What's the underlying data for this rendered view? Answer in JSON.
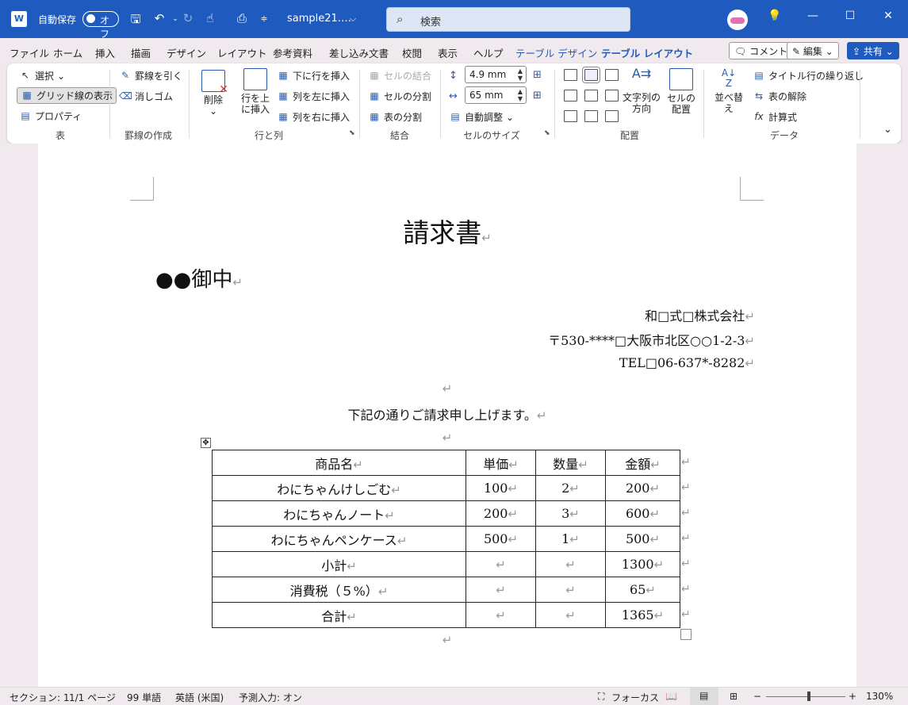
{
  "titlebar": {
    "app_icon": "W",
    "autosave_label": "自動保存",
    "autosave_state": "オフ",
    "file_name": "sample21.…",
    "search_placeholder": "検索",
    "icons": [
      "save-icon",
      "undo-icon",
      "redo-icon",
      "touch-mode-icon",
      "quick-access-icon",
      "customize-icon"
    ]
  },
  "menu": {
    "tabs": [
      "ファイル",
      "ホーム",
      "挿入",
      "描画",
      "デザイン",
      "レイアウト",
      "参考資料",
      "差し込み文書",
      "校閲",
      "表示",
      "ヘルプ",
      "テーブル デザイン",
      "テーブル レイアウト"
    ],
    "comment_label": "コメント",
    "edit_label": "編集",
    "share_label": "共有"
  },
  "ribbon": {
    "table": {
      "select": "選択",
      "gridlines": "グリッド線の表示",
      "properties": "プロパティ",
      "group": "表"
    },
    "draw": {
      "draw_border": "罫線を引く",
      "eraser": "消しゴム",
      "group": "罫線の作成"
    },
    "rows_cols": {
      "delete": "削除",
      "insert_above": "行を上\nに挿入",
      "insert_below": "下に行を挿入",
      "insert_left": "列を左に挿入",
      "insert_right": "列を右に挿入",
      "group": "行と列"
    },
    "merge": {
      "merge_cells": "セルの結合",
      "split_cells": "セルの分割",
      "split_table": "表の分割",
      "group": "結合"
    },
    "cell_size": {
      "height": "4.9 mm",
      "width": "65 mm",
      "autofit": "自動調整",
      "group": "セルのサイズ"
    },
    "alignment": {
      "text_direction": "文字列の\n方向",
      "cell_margins": "セルの\n配置",
      "group": "配置"
    },
    "data": {
      "sort": "並べ替え",
      "repeat_header": "タイトル行の繰り返し",
      "convert": "表の解除",
      "formula": "計算式",
      "group": "データ"
    }
  },
  "document": {
    "title": "請求書",
    "recipient": "●●御中",
    "company": "和□式□株式会社",
    "address": "〒530-****□大阪市北区○○1-2-3",
    "tel": "TEL□06-637*-8282",
    "intro": "下記の通りご請求申し上げます。",
    "para_mark": "↵",
    "table": {
      "headers": [
        "商品名",
        "単価",
        "数量",
        "金額"
      ],
      "rows": [
        [
          "わにちゃんけしごむ",
          "100",
          "2",
          "200"
        ],
        [
          "わにちゃんノート",
          "200",
          "3",
          "600"
        ],
        [
          "わにちゃんペンケース",
          "500",
          "1",
          "500"
        ],
        [
          "小計",
          "",
          "",
          "1300"
        ],
        [
          "消費税（５%）",
          "",
          "",
          "65"
        ],
        [
          "合計",
          "",
          "",
          "1365"
        ]
      ]
    }
  },
  "statusbar": {
    "section": "セクション: 1",
    "page": "1/1 ページ",
    "words": "99 単語",
    "language": "英語 (米国)",
    "predictive": "予測入力: オン",
    "focus": "フォーカス",
    "zoom": "130%"
  }
}
